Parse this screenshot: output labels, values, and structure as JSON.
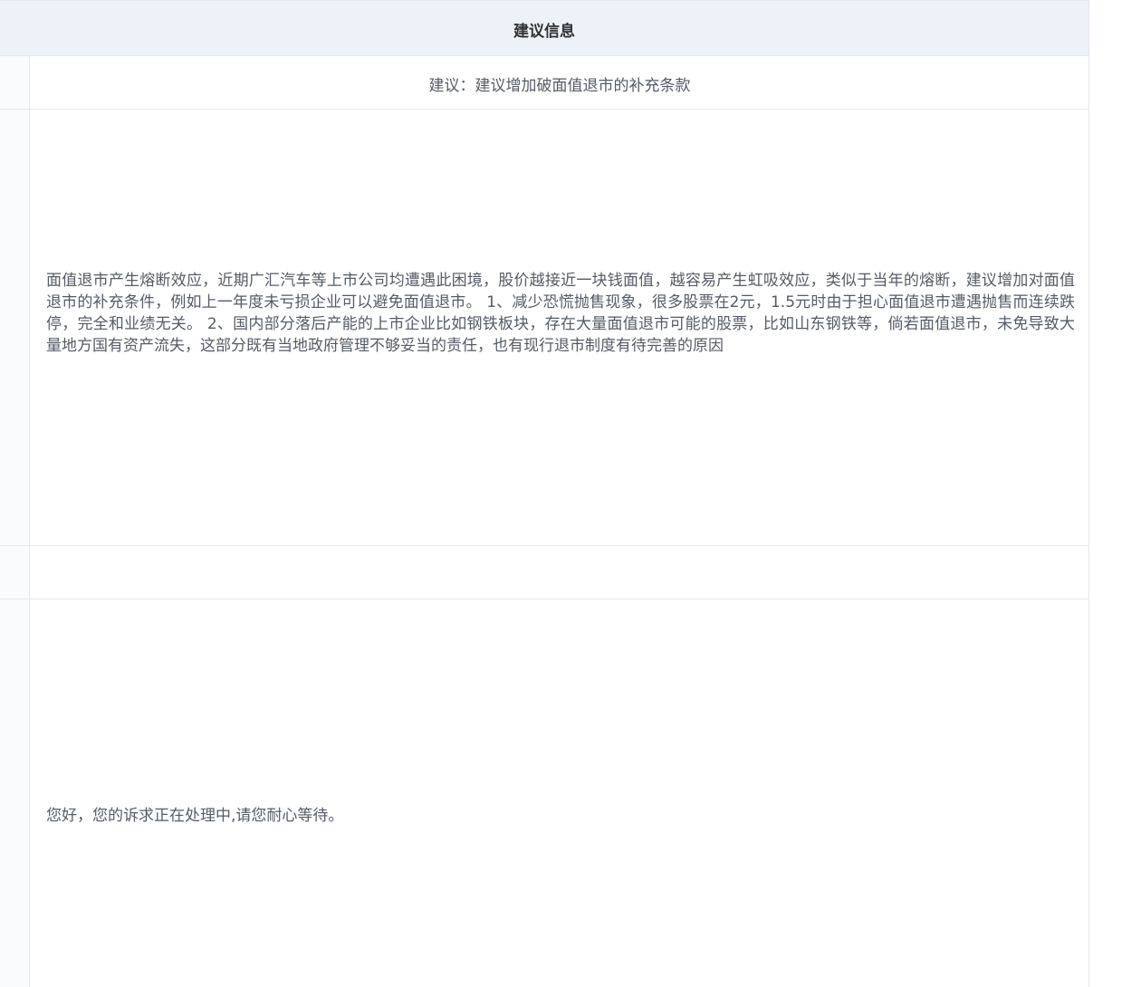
{
  "section": {
    "header_title": "建议信息"
  },
  "suggestion": {
    "title": "建议：建议增加破面值退市的补充条款",
    "content": "面值退市产生熔断效应，近期广汇汽车等上市公司均遭遇此困境，股价越接近一块钱面值，越容易产生虹吸效应，类似于当年的熔断，建议增加对面值退市的补充条件，例如上一年度未亏损企业可以避免面值退市。 1、减少恐慌抛售现象，很多股票在2元，1.5元时由于担心面值退市遭遇抛售而连续跌停，完全和业绩无关。 2、国内部分落后产能的上市企业比如钢铁板块，存在大量面值退市可能的股票，比如山东钢铁等，倘若面值退市，未免导致大量地方国有资产流失，这部分既有当地政府管理不够妥当的责任，也有现行退市制度有待完善的原因",
    "empty_value": "",
    "reply": "您好，您的诉求正在处理中,请您耐心等待。"
  }
}
